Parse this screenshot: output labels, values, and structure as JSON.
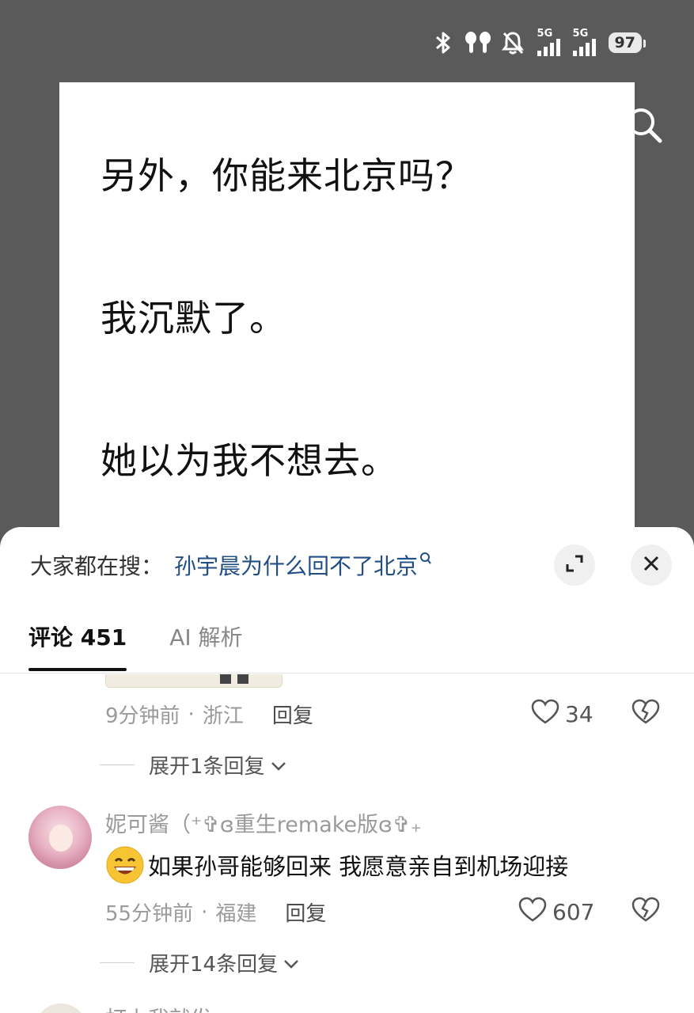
{
  "status_bar": {
    "network_label_1": "5G",
    "network_label_2": "5G",
    "battery": "97",
    "icons": [
      "bluetooth-icon",
      "earbuds-icon",
      "mute-bell-icon",
      "signal-icon",
      "signal-icon",
      "battery-icon"
    ]
  },
  "story": {
    "lines": [
      "另外，你能来北京吗？",
      "我沉默了。",
      "她以为我不想去。"
    ]
  },
  "panel": {
    "trending_label": "大家都在搜：",
    "trending_query": "孙宇晨为什么回不了北京",
    "tabs": [
      {
        "label": "评论 451",
        "active": true
      },
      {
        "label": "AI 解析",
        "active": false
      }
    ]
  },
  "comments": [
    {
      "time": "9分钟前",
      "separator": "·",
      "location": "浙江",
      "reply_label": "回复",
      "likes": "34",
      "expand_label": "展开1条回复"
    },
    {
      "username": "妮可酱（⁺✞ɞ重生remake版ɞ✞₊",
      "text": "如果孙哥能够回来 我愿意亲自到机场迎接",
      "emoji": "grinning-face-emoji",
      "time": "55分钟前",
      "separator": "·",
      "location": "福建",
      "reply_label": "回复",
      "likes": "607",
      "expand_label": "展开14条回复"
    }
  ],
  "next_comment_partial_name": "打上我就发",
  "colors": {
    "backdrop": "#5a5a5a",
    "link": "#214f85",
    "muted_text": "#9a9a9a"
  }
}
